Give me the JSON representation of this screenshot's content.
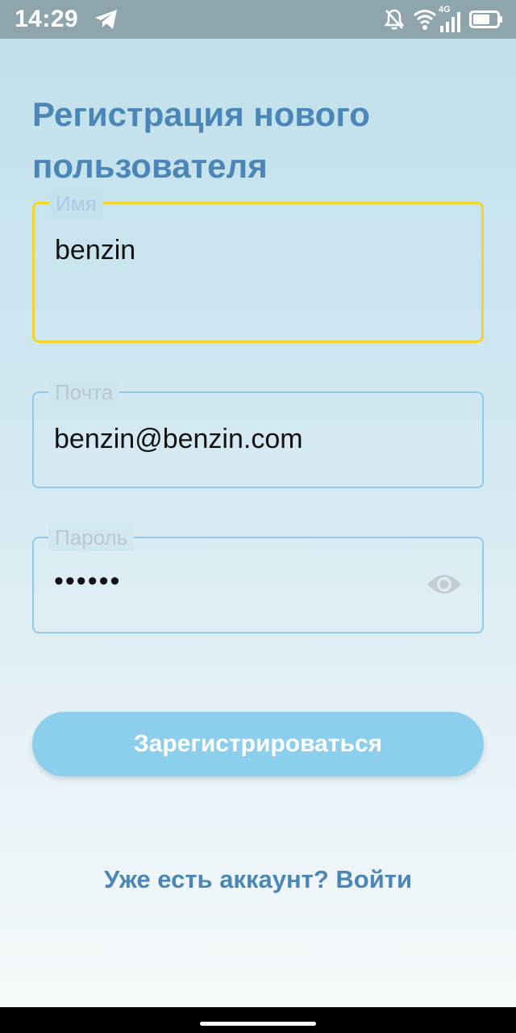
{
  "status_bar": {
    "time": "14:29",
    "network": "4G",
    "icons": [
      "telegram-icon",
      "muted-bell-icon",
      "wifi-icon",
      "signal-icon",
      "battery-icon"
    ]
  },
  "page": {
    "title": "Регистрация нового пользователя"
  },
  "form": {
    "name": {
      "label": "Имя",
      "value": "benzin"
    },
    "email": {
      "label": "Почта",
      "value": "benzin@benzin.com"
    },
    "password": {
      "label": "Пароль",
      "value": "••••••",
      "toggle_icon": "eye-icon"
    },
    "submit_label": "Зарегистрироваться"
  },
  "footer": {
    "login_link": "Уже есть аккаунт? Войти"
  },
  "colors": {
    "accent": "#4a86b8",
    "button": "#8ccfec",
    "focus_border": "#f2d52a",
    "field_border": "#8fcbe9",
    "status_bar": "#8fa5ad"
  }
}
